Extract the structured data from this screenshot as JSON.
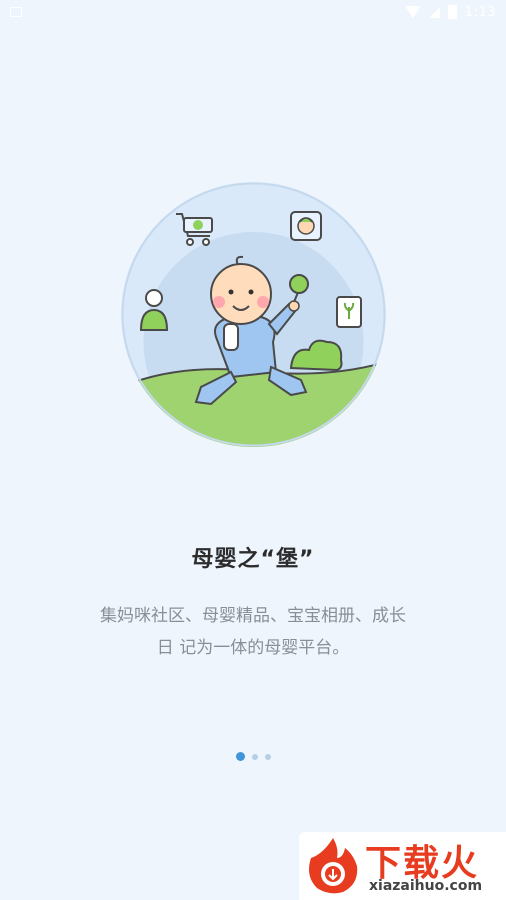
{
  "status_bar": {
    "time": "1:13",
    "icons": [
      "notification-icon",
      "wifi-icon",
      "signal-icon",
      "battery-icon"
    ]
  },
  "onboarding": {
    "title": "母婴之“堡”",
    "description_line1": "集妈咪社区、母婴精品、宝宝相册、成长",
    "description_line2": "日 记为一体的母婴平台。",
    "page_indicator": {
      "total": 3,
      "active": 1
    }
  },
  "watermark": {
    "brand": "下载火",
    "url": "xiazaihuo.com"
  },
  "colors": {
    "background": "#eef5fd",
    "accent": "#3f95d8",
    "title": "#2c2c2c",
    "description": "#8a8f96",
    "watermark_red": "#e73c1f"
  }
}
